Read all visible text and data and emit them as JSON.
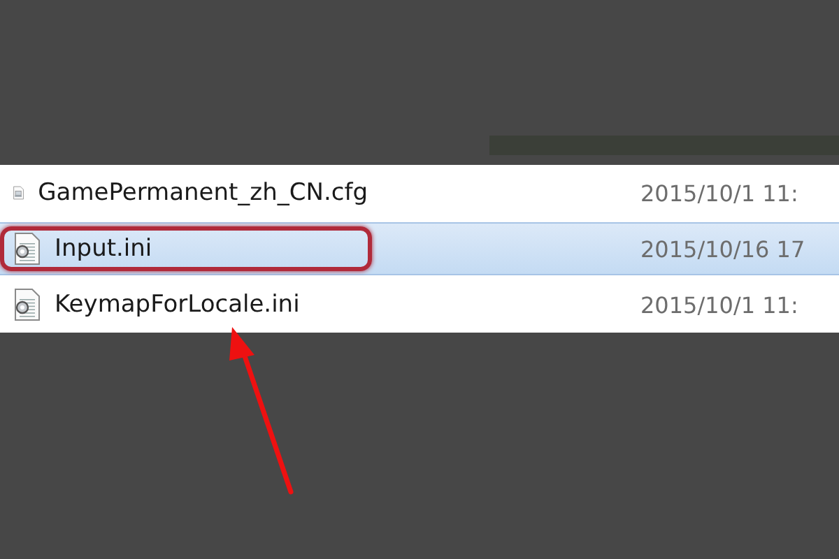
{
  "files": [
    {
      "name": "GamePermanent_zh_CN.cfg",
      "modified": "2015/10/1 11:",
      "kind": "cfg",
      "selected": false,
      "circled": false
    },
    {
      "name": "Input.ini",
      "modified": "2015/10/16 17",
      "kind": "ini",
      "selected": true,
      "circled": true
    },
    {
      "name": "KeymapForLocale.ini",
      "modified": "2015/10/1 11:",
      "kind": "ini",
      "selected": false,
      "circled": false
    }
  ],
  "annotation": {
    "kind": "arrow"
  }
}
